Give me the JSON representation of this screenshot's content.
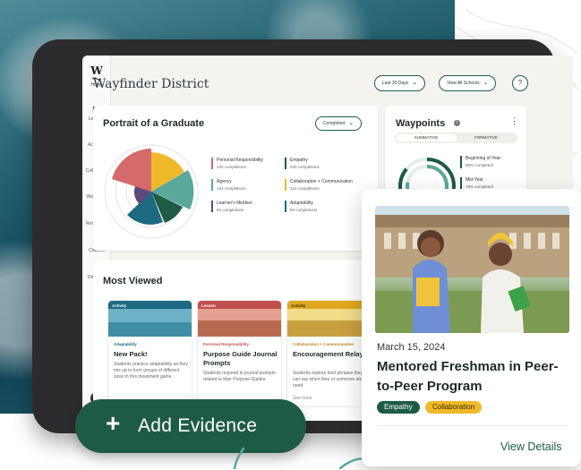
{
  "sidebar": {
    "logo": "W",
    "logo_sub": "Home",
    "items": [
      {
        "label": "Lessons",
        "icon": "book-icon"
      },
      {
        "label": "Activities",
        "icon": "person-run-icon"
      },
      {
        "label": "Collections",
        "icon": "folder-icon"
      },
      {
        "label": "Waypoints",
        "icon": "navigation-arrow-icon"
      },
      {
        "label": "Resources",
        "icon": "lightbulb-icon"
      },
      {
        "label": "Classes",
        "icon": "people-icon"
      },
      {
        "label": "Directory",
        "icon": "contact-card-icon"
      }
    ]
  },
  "header": {
    "title": "Wayfinder District",
    "range_label": "Last 30 Days",
    "school_label": "View All Schools",
    "help": "?"
  },
  "portrait": {
    "title": "Portrait of a Graduate",
    "filter": "Completed",
    "legend": [
      {
        "label": "Personal Responsibility",
        "sub": "220 completions",
        "color": "#d46a6a"
      },
      {
        "label": "Empathy",
        "sub": "220 completions",
        "color": "#1e5b45"
      },
      {
        "label": "Agency",
        "sub": "124 completions",
        "color": "#5aa89a"
      },
      {
        "label": "Collaboration + Communication",
        "sub": "124 completions",
        "color": "#f0b92a"
      },
      {
        "label": "Learner's Mindset",
        "sub": "60 completions",
        "color": "#5e4a7a"
      },
      {
        "label": "Adaptability",
        "sub": "60 completions",
        "color": "#1b6a82"
      }
    ]
  },
  "waypoints": {
    "title": "Waypoints",
    "tabs": [
      "SUMMATIVE",
      "FORMATIVE"
    ],
    "items": [
      {
        "label": "Beginning of Year",
        "sub": "86% completed",
        "value": 0.86
      },
      {
        "label": "Mid-Year",
        "sub": "78% completed",
        "value": 0.78
      }
    ]
  },
  "most_viewed": {
    "title": "Most Viewed",
    "cards": [
      {
        "tag": "Activity",
        "category": "Adaptability",
        "title": "New Pack!",
        "desc": "Students practice adaptability as they mix up to form groups of different sizes in this movement game.",
        "color": "#1b6a82"
      },
      {
        "tag": "Lesson",
        "category": "Personal Responsibility",
        "title": "Purpose Guide Journal Prompts",
        "desc": "Students respond to journal prompts related to their Purpose Guides.",
        "color": "#c0504d"
      },
      {
        "tag": "Activity",
        "category": "Collaboration + Communication",
        "title": "Encouragement Relay",
        "desc": "Students explore kind phrases they can say when they or someone else need",
        "more": "See more",
        "color": "#e0a820"
      }
    ]
  },
  "add_evidence": {
    "label": "Add Evidence",
    "plus": "+"
  },
  "feature": {
    "date": "March 15, 2024",
    "title": "Mentored Freshman in Peer-to-Peer Program",
    "tags": [
      {
        "label": "Empathy",
        "bg": "#1e5b45",
        "fg": "#ffffff"
      },
      {
        "label": "Collaboration",
        "bg": "#f0b92a",
        "fg": "#3a2a00"
      }
    ],
    "link": "View Details"
  }
}
